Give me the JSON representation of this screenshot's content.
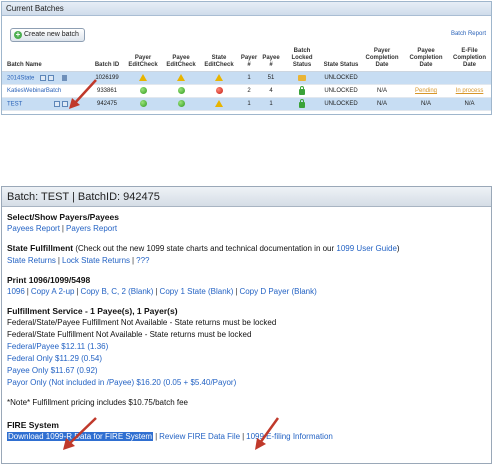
{
  "top": {
    "header": "Current Batches",
    "create_btn": "Create new batch",
    "batch_report": "Batch Report",
    "columns": [
      "Batch Name",
      "Batch ID",
      "Payer EditCheck",
      "Payee EditCheck",
      "State EditCheck",
      "Payer #",
      "Payee #",
      "Batch Locked Status",
      "State Status",
      "Payer Completion Date",
      "Payee Completion Date",
      "E-File Completion Date"
    ],
    "rows": [
      {
        "name": "2014State",
        "id": "1026199",
        "payer_no": "1",
        "payee_no": "51",
        "state_status": "UNLOCKED",
        "payer_date": "",
        "payee_date": "",
        "efile_date": ""
      },
      {
        "name": "KatiesWebinarBatch",
        "id": "933861",
        "payer_no": "2",
        "payee_no": "4",
        "state_status": "UNLOCKED",
        "payer_date": "N/A",
        "payee_date": "Pending",
        "efile_date": "In process"
      },
      {
        "name": "TEST",
        "id": "942475",
        "payer_no": "1",
        "payee_no": "1",
        "state_status": "UNLOCKED",
        "payer_date": "N/A",
        "payee_date": "N/A",
        "efile_date": "N/A"
      }
    ]
  },
  "bottom": {
    "header": "Batch: TEST | BatchID: 942475",
    "select_title": "Select/Show Payers/Payees",
    "select_links": [
      "Payees Report",
      "Payers Report"
    ],
    "state_title": "State Fulfillment",
    "state_desc": " (Check out the new 1099 state charts and technical documentation in our ",
    "state_guide": "1099 User Guide",
    "state_close": ")",
    "state_links": [
      "State Returns",
      "Lock State Returns",
      "???"
    ],
    "print_title": "Print 1096/1099/5498",
    "print_links": [
      "1096",
      "Copy A 2-up",
      "Copy B, C, 2 (Blank)",
      "Copy 1 State (Blank)",
      "Copy D Payer (Blank)"
    ],
    "fulfill_title": "Fulfillment Service - 1 Payee(s), 1 Payer(s)",
    "fulfill_notes": [
      "Federal/State/Payee Fulfillment Not Available - State returns must be locked",
      "Federal/State Fulfillment Not Available - State returns must be locked"
    ],
    "fulfill_links": [
      "Federal/Payee $12.11 (1.36)",
      "Federal Only $11.29 (0.54)",
      "Payee Only $11.67 (0.92)",
      "Payor Only (Not included in /Payee) $16.20 (0.05 + $5.40/Payor)"
    ],
    "note": "*Note* Fulfillment pricing includes $10.75/batch fee",
    "fire_title": "FIRE System",
    "fire_links": [
      "Download 1099-R Data for FIRE System",
      "Review FIRE Data File",
      "1099 E-filing Information"
    ]
  },
  "colors": {
    "link": "#2463c4",
    "row_highlight": "#c7ddf3",
    "arrow": "#c0392b",
    "warn": "#e8b400"
  }
}
